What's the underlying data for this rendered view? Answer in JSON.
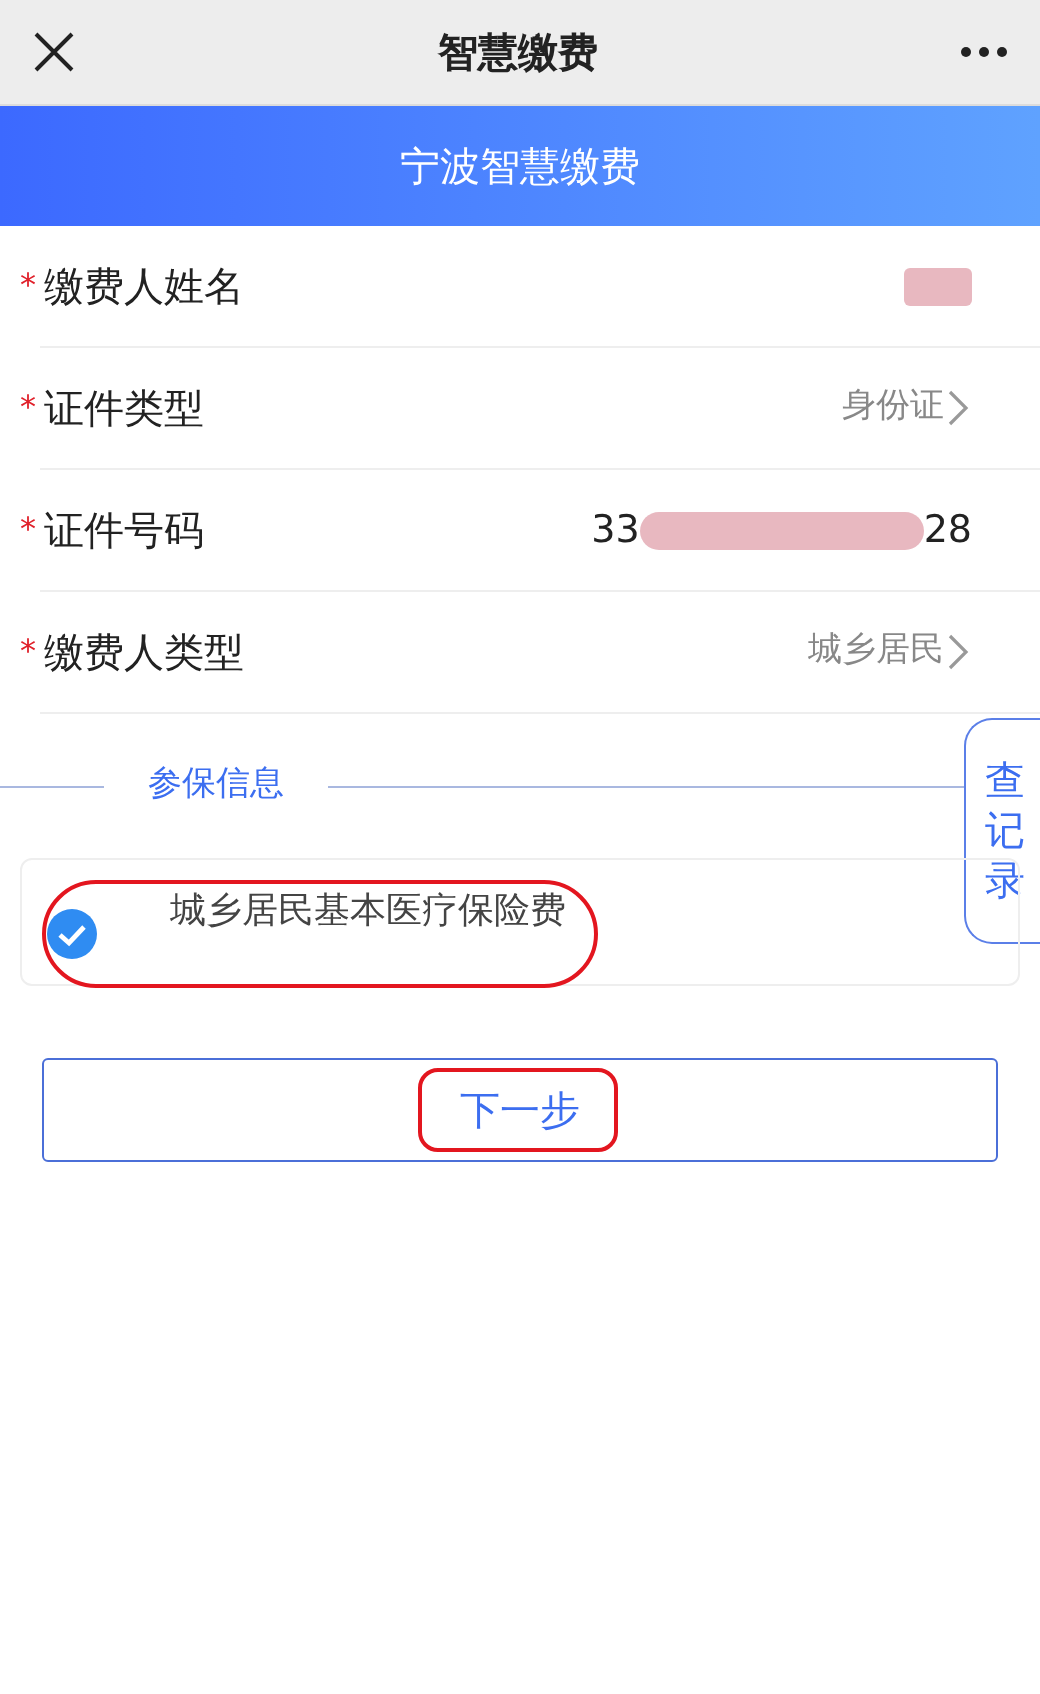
{
  "top_bar": {
    "title": "智慧缴费"
  },
  "banner": {
    "title": "宁波智慧缴费"
  },
  "fields": [
    {
      "required_mark": "*",
      "label": "缴费人姓名",
      "kind": "redacted"
    },
    {
      "required_mark": "*",
      "label": "证件类型",
      "kind": "select",
      "value": "身份证"
    },
    {
      "required_mark": "*",
      "label": "证件号码",
      "kind": "masked",
      "prefix": "33",
      "suffix": "28"
    },
    {
      "required_mark": "*",
      "label": "缴费人类型",
      "kind": "select",
      "value": "城乡居民"
    }
  ],
  "section": {
    "title": "参保信息"
  },
  "side_tab": {
    "label": "查记录"
  },
  "insurance_items": [
    {
      "label": "城乡居民基本医疗保险费",
      "checked": true,
      "annotated": true
    }
  ],
  "next_button": {
    "label": "下一步",
    "annotated": true
  }
}
